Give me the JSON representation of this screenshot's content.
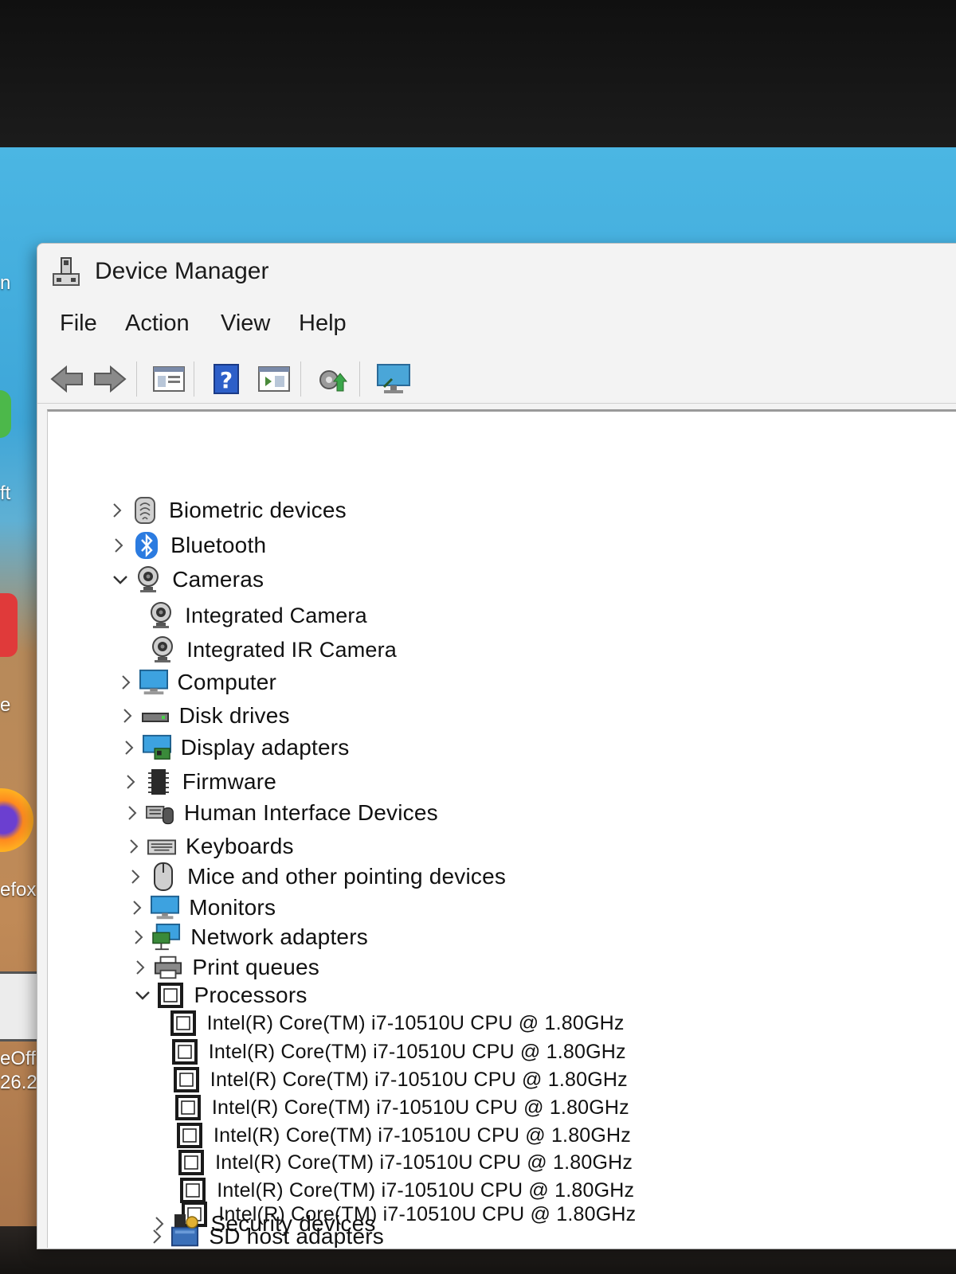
{
  "window": {
    "title": "Device Manager"
  },
  "menu": [
    "File",
    "Action",
    "View",
    "Help"
  ],
  "toolbar": [
    "back-icon",
    "forward-icon",
    "properties-icon",
    "help-icon",
    "update-driver-icon",
    "scan-hardware-icon",
    "monitor-icon"
  ],
  "desktop_labels": {
    "partial_1": "n",
    "partial_2": "ft",
    "partial_3": "e",
    "partial_4": "efox",
    "partial_5": "eOffice",
    "partial_6": "26.2"
  },
  "tree": {
    "categories": [
      {
        "label": "Biometric devices",
        "expanded": false,
        "icon": "fingerprint-icon"
      },
      {
        "label": "Bluetooth",
        "expanded": false,
        "icon": "bluetooth-icon"
      },
      {
        "label": "Cameras",
        "expanded": true,
        "icon": "camera-icon",
        "children": [
          "Integrated Camera",
          "Integrated IR Camera"
        ]
      },
      {
        "label": "Computer",
        "expanded": false,
        "icon": "computer-icon"
      },
      {
        "label": "Disk drives",
        "expanded": false,
        "icon": "disk-drive-icon"
      },
      {
        "label": "Display adapters",
        "expanded": false,
        "icon": "display-adapter-icon"
      },
      {
        "label": "Firmware",
        "expanded": false,
        "icon": "firmware-icon"
      },
      {
        "label": "Human Interface Devices",
        "expanded": false,
        "icon": "hid-icon"
      },
      {
        "label": "Keyboards",
        "expanded": false,
        "icon": "keyboard-icon"
      },
      {
        "label": "Mice and other pointing devices",
        "expanded": false,
        "icon": "mouse-icon"
      },
      {
        "label": "Monitors",
        "expanded": false,
        "icon": "monitor-icon"
      },
      {
        "label": "Network adapters",
        "expanded": false,
        "icon": "network-adapter-icon"
      },
      {
        "label": "Print queues",
        "expanded": false,
        "icon": "printer-icon"
      },
      {
        "label": "Processors",
        "expanded": true,
        "icon": "processor-icon",
        "children": [
          "Intel(R) Core(TM) i7-10510U CPU @ 1.80GHz",
          "Intel(R) Core(TM) i7-10510U CPU @ 1.80GHz",
          "Intel(R) Core(TM) i7-10510U CPU @ 1.80GHz",
          "Intel(R) Core(TM) i7-10510U CPU @ 1.80GHz",
          "Intel(R) Core(TM) i7-10510U CPU @ 1.80GHz",
          "Intel(R) Core(TM) i7-10510U CPU @ 1.80GHz",
          "Intel(R) Core(TM) i7-10510U CPU @ 1.80GHz",
          "Intel(R) Core(TM) i7-10510U CPU @ 1.80GHz"
        ]
      },
      {
        "label": "SD host adapters",
        "expanded": false,
        "icon": "sd-host-adapter-icon"
      },
      {
        "label": "Security devices",
        "expanded": false,
        "icon": "security-device-icon"
      }
    ]
  }
}
